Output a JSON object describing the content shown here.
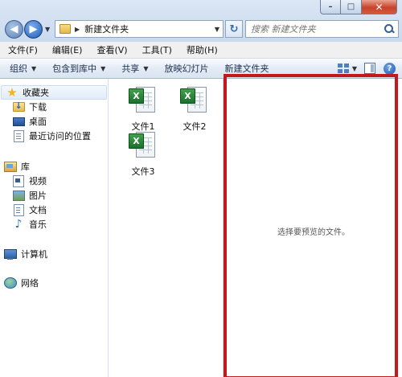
{
  "window": {
    "caption": {
      "minimize": "–",
      "maximize": "□",
      "close": "✕"
    }
  },
  "address_bar": {
    "path": "新建文件夹",
    "search_placeholder": "搜索 新建文件夹"
  },
  "menu": [
    "文件(F)",
    "编辑(E)",
    "查看(V)",
    "工具(T)",
    "帮助(H)"
  ],
  "toolbar": {
    "organize": "组织",
    "include_library": "包含到库中",
    "share": "共享",
    "slideshow": "放映幻灯片",
    "new_folder": "新建文件夹"
  },
  "nav": {
    "favorites": "收藏夹",
    "downloads": "下载",
    "desktop": "桌面",
    "recent": "最近访问的位置",
    "libraries": "库",
    "videos": "视频",
    "pictures": "图片",
    "documents": "文档",
    "music": "音乐",
    "computer": "计算机",
    "network": "网络"
  },
  "files": [
    {
      "name": "文件1",
      "icon": "excel-file-icon"
    },
    {
      "name": "文件2",
      "icon": "excel-file-icon"
    },
    {
      "name": "文件3",
      "icon": "excel-file-icon"
    }
  ],
  "preview": {
    "message": "选择要预览的文件。",
    "highlight_color": "#c3191a"
  }
}
